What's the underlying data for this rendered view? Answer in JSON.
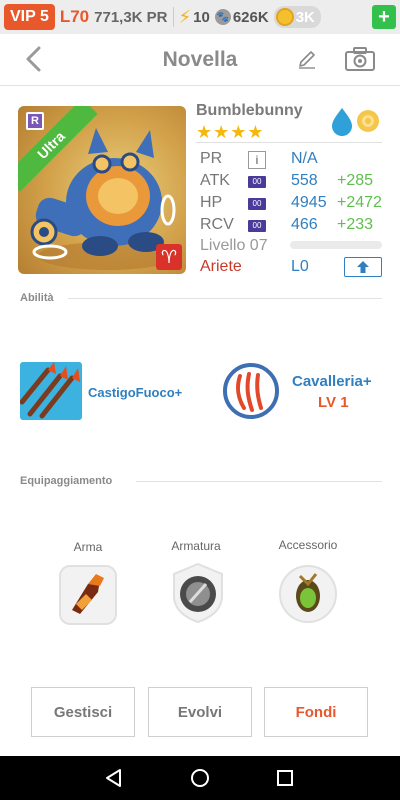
{
  "status": {
    "vip": "VIP 5",
    "level": "L70",
    "power": "771,3K PR",
    "energy": "10",
    "paws": "626K",
    "coins": "3K",
    "plus": "+"
  },
  "header": {
    "title": "Novella"
  },
  "hero": {
    "name": "Bumblebunny",
    "stars": "★★★★",
    "rarity": "Ultra",
    "rarity_badge": "R",
    "stats": [
      {
        "label": "PR",
        "value": "N/A",
        "bonus": ""
      },
      {
        "label": "ATK",
        "value": "558",
        "bonus": "+285"
      },
      {
        "label": "HP",
        "value": "4945",
        "bonus": "+2472"
      },
      {
        "label": "RCV",
        "value": "466",
        "bonus": "+233"
      }
    ],
    "stat_box_text": "00",
    "info_text": "i",
    "level_label": "Livello 07",
    "sign_label": "Ariete",
    "sign_value": "L0"
  },
  "abilities": {
    "label": "Abilità",
    "skill1": "CastigoFuoco+",
    "skill2": "Cavalleria+",
    "skill2_level": "LV 1"
  },
  "equipment": {
    "label": "Equipaggiamento",
    "slots": [
      "Arma",
      "Armatura",
      "Accessorio"
    ]
  },
  "actions": {
    "manage": "Gestisci",
    "evolve": "Evolvi",
    "merge": "Fondi"
  },
  "colors": {
    "accent_orange": "#e8582b",
    "stat_blue": "#2f7fc1",
    "bonus_green": "#5fbf4d",
    "star_gold": "#f5b80e"
  }
}
